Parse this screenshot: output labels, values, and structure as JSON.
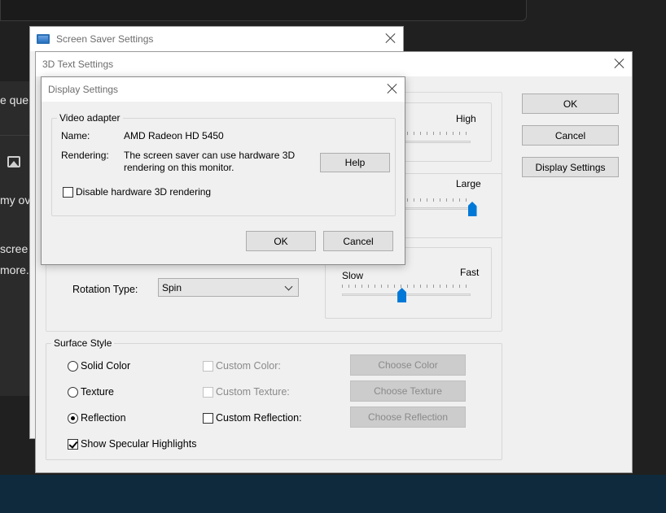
{
  "background_app": {
    "lines": [
      "e que",
      "my ov",
      "scree",
      "more."
    ]
  },
  "screen_saver_settings": {
    "title": "Screen Saver Settings"
  },
  "text3d_settings": {
    "title": "3D Text Settings",
    "ok_label": "OK",
    "cancel_label": "Cancel",
    "display_settings_label": "Display Settings",
    "resolution_high_label": "High",
    "size_large_label": "Large",
    "speed_slow_label": "Slow",
    "speed_fast_label": "Fast",
    "size_value": 1.0,
    "speed_value": 0.46,
    "rotation_type_label": "Rotation Type:",
    "rotation_type_value": "Spin",
    "surface_style": {
      "label": "Surface Style",
      "solid_color_label": "Solid Color",
      "texture_label": "Texture",
      "reflection_label": "Reflection",
      "selected": "reflection",
      "custom_color_label": "Custom Color:",
      "custom_texture_label": "Custom Texture:",
      "custom_reflection_label": "Custom Reflection:",
      "choose_color_label": "Choose Color",
      "choose_texture_label": "Choose Texture",
      "choose_reflection_label": "Choose Reflection",
      "show_specular_label": "Show Specular Highlights",
      "show_specular_checked": true
    }
  },
  "display_settings": {
    "title": "Display Settings",
    "video_adapter_label": "Video adapter",
    "name_label": "Name:",
    "name_value": "AMD Radeon HD 5450",
    "rendering_label": "Rendering:",
    "rendering_line1": "The screen saver can use hardware 3D",
    "rendering_line2": "rendering on this monitor.",
    "help_label": "Help",
    "disable_hw_label": "Disable hardware 3D rendering",
    "ok_label": "OK",
    "cancel_label": "Cancel"
  }
}
